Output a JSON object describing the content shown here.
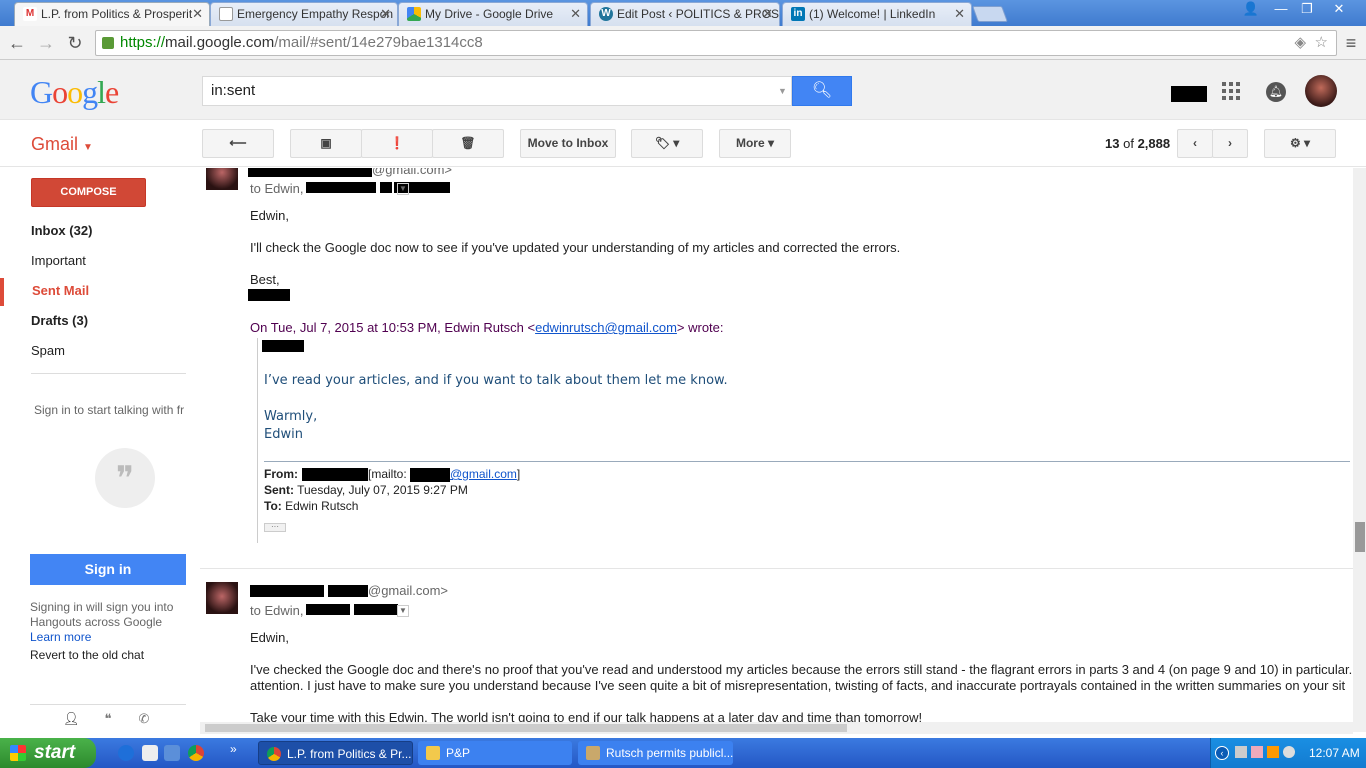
{
  "browser": {
    "tabs": [
      {
        "title": "L.P. from Politics & Prosperit",
        "favicon": "gmail-icon",
        "active": true
      },
      {
        "title": "Emergency Empathy Respon",
        "favicon": "doc-icon",
        "active": false
      },
      {
        "title": "My Drive - Google Drive",
        "favicon": "drive-icon",
        "active": false
      },
      {
        "title": "Edit Post ‹ POLITICS & PROS",
        "favicon": "wordpress-icon",
        "active": false
      },
      {
        "title": "(1) Welcome! | LinkedIn",
        "favicon": "linkedin-icon",
        "active": false
      }
    ],
    "url_scheme": "https://",
    "url_host": "mail.google.com",
    "url_rest": "/mail/#sent/14e279bae1314cc8"
  },
  "header": {
    "logo": "Google",
    "search_value": "in:sent"
  },
  "gmail_toolbar": {
    "app_label": "Gmail",
    "move_to_inbox": "Move to Inbox",
    "more": "More",
    "count_current": "13",
    "count_of": "of",
    "count_total": "2,888"
  },
  "nav": {
    "compose": "COMPOSE",
    "items": [
      {
        "label": "Inbox (32)"
      },
      {
        "label": "Important"
      },
      {
        "label": "Sent Mail"
      },
      {
        "label": "Drafts (3)"
      },
      {
        "label": "Spam"
      }
    ],
    "hangouts_prompt": "Sign in to start talking with fr",
    "sign_in": "Sign in",
    "signin_hint": "Signing in will sign you into Hangouts across Google",
    "learn_more": "Learn more",
    "revert": "Revert to the old chat"
  },
  "messages": [
    {
      "from_suffix": "@gmail.com>",
      "to_prefix": "to Edwin,",
      "greeting": "Edwin,",
      "line1": "I'll check the Google doc now to see if you've updated your understanding of my articles and corrected the errors.",
      "closing": "Best,",
      "reply_header_pre": "On Tue, Jul 7, 2015 at 10:53 PM, Edwin Rutsch <",
      "reply_header_email": "edwinrutsch@gmail.com",
      "reply_header_post": "> wrote:",
      "quote_body": "I’ve read your articles, and if you want to talk about them let me know.",
      "quote_sign1": "Warmly,",
      "quote_sign2": "Edwin",
      "from_label": "From:",
      "mailto_pre": "[mailto:",
      "mailto_domain": "@gmail.com",
      "mailto_post": "]",
      "sent_label": "Sent:",
      "sent_value": "Tuesday, July 07, 2015 9:27 PM",
      "to_label": "To:",
      "to_value": "Edwin Rutsch",
      "ellipsis": "···"
    },
    {
      "from_suffix": "@gmail.com>",
      "to_prefix": "to Edwin,",
      "greeting": "Edwin,",
      "line1": "I've checked the Google doc and there's no proof that you've read and understood my articles because the errors still stand - the flagrant errors in parts 3 and 4 (on page 9 and 10) in particular.",
      "line2": "attention. I just have to make sure you understand because I've seen quite a bit of misrepresentation, twisting of facts, and inaccurate portrayals contained in the written summaries on your sit",
      "line3": "Take your time with this Edwin. The world isn't going to end if our talk happens at a later day and time than tomorrow!"
    }
  ],
  "taskbar": {
    "start": "start",
    "items": [
      {
        "label": "L.P. from Politics & Pr..."
      },
      {
        "label": "P&P"
      },
      {
        "label": "Rutsch permits publicl..."
      }
    ],
    "clock": "12:07 AM"
  }
}
